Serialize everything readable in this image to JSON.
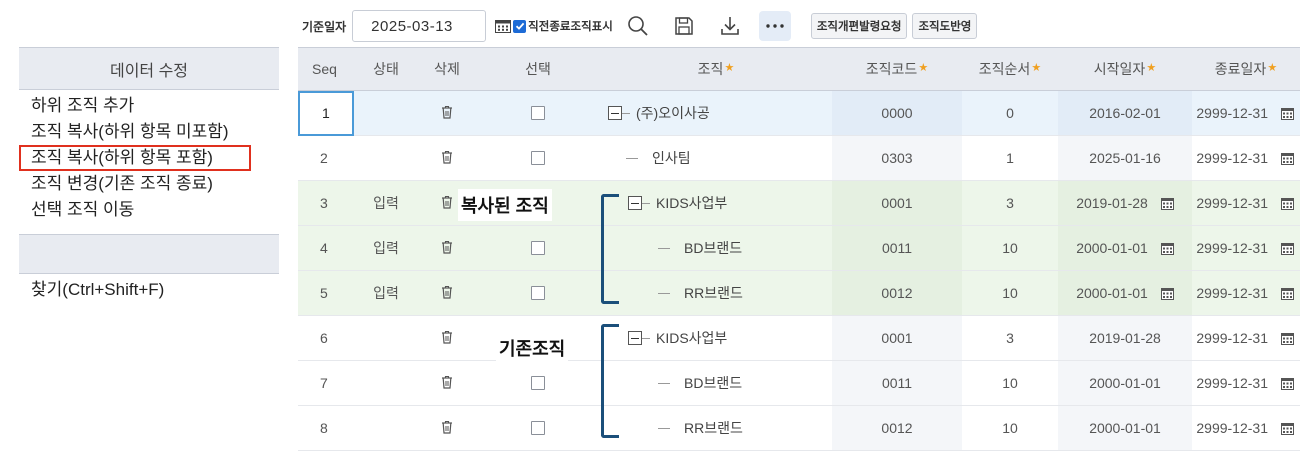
{
  "menu": {
    "header": "데이터 수정",
    "items": [
      {
        "label": "하위 조직 추가"
      },
      {
        "label": "조직 복사(하위 항목 미포함)"
      },
      {
        "label": "조직 복사(하위 항목 포함)"
      },
      {
        "label": "조직 변경(기존 조직 종료)"
      },
      {
        "label": "선택 조직 이동"
      }
    ],
    "find": "찾기(Ctrl+Shift+F)"
  },
  "toolbar": {
    "date_label": "기준일자",
    "date_value": "2025-03-13",
    "checkbox_label": "직전종료조직표시",
    "btn_reorg": "조직개편발령요청",
    "btn_chart": "조직도반영"
  },
  "grid": {
    "columns": [
      "Seq",
      "상태",
      "삭제",
      "선택",
      "조직",
      "조직코드",
      "조직순서",
      "시작일자",
      "종료일자"
    ],
    "rows": [
      {
        "seq": "1",
        "state": "",
        "org": "(주)오이사공",
        "code": "0000",
        "order": "0",
        "start": "2016-02-01",
        "end": "2999-12-31"
      },
      {
        "seq": "2",
        "state": "",
        "org": "인사팀",
        "code": "0303",
        "order": "1",
        "start": "2025-01-16",
        "end": "2999-12-31"
      },
      {
        "seq": "3",
        "state": "입력",
        "org": "KIDS사업부",
        "code": "0001",
        "order": "3",
        "start": "2019-01-28",
        "end": "2999-12-31"
      },
      {
        "seq": "4",
        "state": "입력",
        "org": "BD브랜드",
        "code": "0011",
        "order": "10",
        "start": "2000-01-01",
        "end": "2999-12-31"
      },
      {
        "seq": "5",
        "state": "입력",
        "org": "RR브랜드",
        "code": "0012",
        "order": "10",
        "start": "2000-01-01",
        "end": "2999-12-31"
      },
      {
        "seq": "6",
        "state": "",
        "org": "KIDS사업부",
        "code": "0001",
        "order": "3",
        "start": "2019-01-28",
        "end": "2999-12-31"
      },
      {
        "seq": "7",
        "state": "",
        "org": "BD브랜드",
        "code": "0011",
        "order": "10",
        "start": "2000-01-01",
        "end": "2999-12-31"
      },
      {
        "seq": "8",
        "state": "",
        "org": "RR브랜드",
        "code": "0012",
        "order": "10",
        "start": "2000-01-01",
        "end": "2999-12-31"
      }
    ]
  },
  "annotations": {
    "copied": "복사된 조직",
    "existing": "기존조직"
  },
  "colors": {
    "accent": "#1d6bd6",
    "selected_row": "#eaf3fb",
    "copied_rows": "#edf6ea",
    "highlight_border": "#e0301e",
    "bracket": "#1b4f7a"
  }
}
